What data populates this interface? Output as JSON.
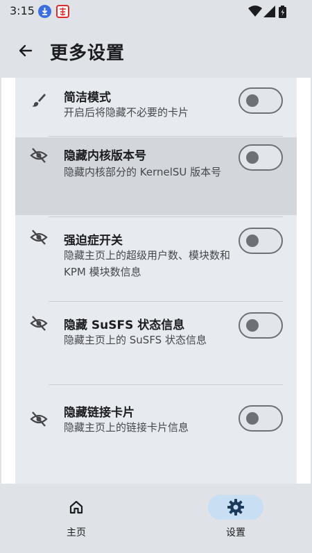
{
  "status_bar": {
    "time": "3:15"
  },
  "app_bar": {
    "title": "更多设置"
  },
  "settings": [
    {
      "title": "简洁模式",
      "description": "开启后将隐藏不必要的卡片",
      "icon": "brush-icon",
      "enabled": false
    },
    {
      "title": "隐藏内核版本号",
      "description": "隐藏内核部分的 KernelSU 版本号",
      "icon": "eye-off-icon",
      "enabled": false
    },
    {
      "title": "强迫症开关",
      "description": "隐藏主页上的超级用户数、模块数和 KPM 模块数信息",
      "icon": "eye-off-icon",
      "enabled": false
    },
    {
      "title": "隐藏 SuSFS 状态信息",
      "description": "隐藏主页上的 SuSFS 状态信息",
      "icon": "eye-off-icon",
      "enabled": false
    },
    {
      "title": "隐藏链接卡片",
      "description": "隐藏主页上的链接卡片信息",
      "icon": "eye-off-icon",
      "enabled": false
    }
  ],
  "bottom_nav": {
    "items": [
      {
        "label": "主页",
        "icon": "home-icon",
        "active": false
      },
      {
        "label": "设置",
        "icon": "gear-icon",
        "active": true
      }
    ]
  },
  "colors": {
    "accent": "#c8def2",
    "surface": "#dfe3e8",
    "card": "#e7ebf0"
  }
}
